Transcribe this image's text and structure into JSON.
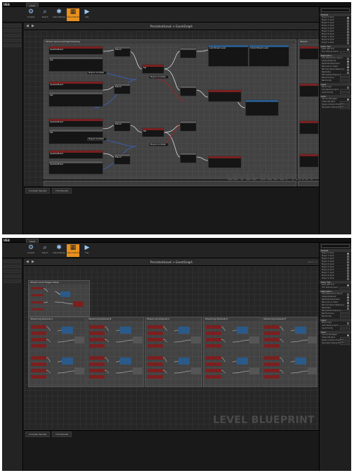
{
  "app": {
    "logo": "UE4",
    "tab_title": "Level"
  },
  "toolbar": {
    "buttons": [
      {
        "label": "Compile",
        "icon": "compile-icon"
      },
      {
        "label": "Search",
        "icon": "search-icon"
      },
      {
        "label": "Class Settings",
        "icon": "gear-icon"
      },
      {
        "label": "Class Defaults",
        "icon": "defaults-icon"
      },
      {
        "label": "Play",
        "icon": "play-icon"
      }
    ]
  },
  "graph": {
    "breadcrumb": "PersistentLevel > EventGraph",
    "zoom": "Zoom -4",
    "watermark": "LEVEL BLUEPRINT"
  },
  "bottom_tabs": [
    "Compiler Results",
    "Find Results"
  ],
  "screenshot1": {
    "comments": [
      "Stream Level Loading/Unloading",
      "Stream"
    ],
    "nodes": [
      "InputAxisEvent",
      "Get",
      "Branch",
      "Load Stream Level",
      "Unload Stream Level",
      "Set",
      "Get",
      "Branch",
      "InputAxisEvent",
      "InputAxisEvent",
      "Branch",
      "InputAxisEvent",
      "Get",
      "Branch",
      "InputAxisEvent",
      "Set"
    ],
    "reroute": [
      "Players Controller",
      "Players Controller",
      "Players Controller",
      "Players Controller"
    ]
  },
  "screenshot2": {
    "comments": [
      "Stream Level Trigger Setup",
      "Streaming Sublevel A",
      "Streaming Sublevel B",
      "Streaming Sublevel C",
      "Streaming Sublevel D",
      "Streaming Sublevel E"
    ]
  },
  "details_panel": {
    "sections": [
      {
        "title": "Default",
        "rows": [
          "Player 0 Input",
          "Player 1 Input",
          "Player 2 Input",
          "Player 3 Input",
          "Player 4 Input",
          "Player 5 Input",
          "Player 6 Input",
          "Player 7 Input",
          "Player 8 Input",
          "Player 9 Input"
        ]
      },
      {
        "title": "Actor Tick",
        "rows": [
          "Start with Tick",
          "Tick Interval (secs)"
        ]
      },
      {
        "title": "Replication",
        "rows": [
          "Only Relevant to Owner",
          "Always Relevant",
          "Replicate Movement",
          "Net Load on Client",
          "Net Use Owner Relevancy",
          "Replicates",
          "Net Update Frequency",
          "Net Dormancy",
          "Net Priority"
        ]
      },
      {
        "title": "Input",
        "rows": [
          "Block Input",
          "Auto Receive Input",
          "Input Priority"
        ]
      },
      {
        "title": "Actor",
        "rows": [
          "Can be Damaged",
          "Initial Life Span",
          "Spawn Collision Handling",
          "Generate Overlap Events"
        ]
      }
    ]
  }
}
